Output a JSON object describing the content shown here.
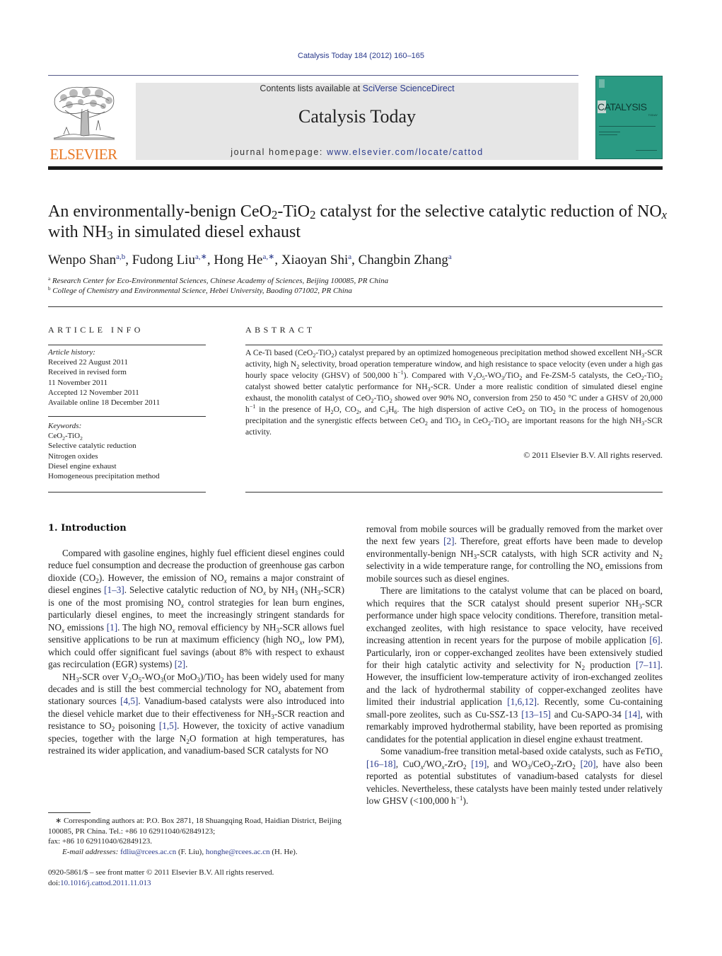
{
  "header": {
    "citation": "Catalysis Today 184 (2012) 160–165",
    "contents_prefix": "Contents lists available at ",
    "contents_link": "SciVerse ScienceDirect",
    "journal_title": "Catalysis Today",
    "homepage_prefix": "journal homepage: ",
    "homepage_link": "www.elsevier.com/locate/cattod",
    "publisher_logo_text": "ELSEVIER",
    "cover_title": "CATALYSIS",
    "cover_subtitle": "TODAY",
    "colors": {
      "link": "#2a3a8c",
      "elsevier_orange": "#e87722",
      "banner_bg": "#e6e6e6",
      "cover_bg": "#2a9a83"
    }
  },
  "article": {
    "title_parts": {
      "p1": "An environmentally-benign CeO",
      "s1": "2",
      "p2": "-TiO",
      "s2": "2",
      "p3": " catalyst for the selective catalytic reduction of NO",
      "s3": "x",
      "p4": " with NH",
      "s4": "3",
      "p5": " in simulated diesel exhaust"
    },
    "authors": [
      {
        "name": "Wenpo Shan",
        "sup": "a,b"
      },
      {
        "name": "Fudong Liu",
        "sup": "a,∗"
      },
      {
        "name": "Hong He",
        "sup": "a,∗"
      },
      {
        "name": "Xiaoyan Shi",
        "sup": "a"
      },
      {
        "name": "Changbin Zhang",
        "sup": "a"
      }
    ],
    "affiliations": [
      {
        "mark": "a",
        "text": "Research Center for Eco-Environmental Sciences, Chinese Academy of Sciences, Beijing 100085, PR China"
      },
      {
        "mark": "b",
        "text": "College of Chemistry and Environmental Science, Hebei University, Baoding 071002, PR China"
      }
    ]
  },
  "article_info": {
    "heading": "ARTICLE INFO",
    "history_label": "Article history:",
    "history": [
      "Received 22 August 2011",
      "Received in revised form",
      "11 November 2011",
      "Accepted 12 November 2011",
      "Available online 18 December 2011"
    ],
    "keywords_label": "Keywords:",
    "keyword_first": {
      "a": "CeO",
      "b": "2",
      "c": "-TiO",
      "d": "2"
    },
    "keywords": [
      "Selective catalytic reduction",
      "Nitrogen oxides",
      "Diesel engine exhaust",
      "Homogeneous precipitation method"
    ]
  },
  "abstract": {
    "heading": "ABSTRACT",
    "copyright": "© 2011 Elsevier B.V. All rights reserved.",
    "t": {
      "a1": "A Ce-Ti based (CeO",
      "a2": "-TiO",
      "a3": ") catalyst prepared by an optimized homogeneous precipitation method showed excellent NH",
      "a4": "-SCR activity, high N",
      "a5": " selectivity, broad operation temperature window, and high resistance to space velocity (even under a high gas hourly space velocity (GHSV) of 500,000 h",
      "a6": "). Compared with V",
      "a7": "O",
      "a8": "-WO",
      "a9": "/TiO",
      "a10": " and Fe-ZSM-5 catalysts, the CeO",
      "a11": "-TiO",
      "a12": " catalyst showed better catalytic performance for NH",
      "a13": "-SCR. Under a more realistic condition of simulated diesel engine exhaust, the monolith catalyst of CeO",
      "a14": "-TiO",
      "a15": " showed over 90% NO",
      "a16": " conversion from 250 to 450 °C under a GHSV of 20,000 h",
      "a17": " in the presence of H",
      "a18": "O, CO",
      "a19": ", and C",
      "a20": "H",
      "a21": ". The high dispersion of active CeO",
      "a22": " on TiO",
      "a23": " in the process of homogenous precipitation and the synergistic effects between CeO",
      "a24": " and TiO",
      "a25": " in CeO",
      "a26": "-TiO",
      "a27": " are important reasons for the high NH",
      "a28": "-SCR activity.",
      "n2": "2",
      "n3": "3",
      "n5": "5",
      "n6": "6",
      "x": "x",
      "m1": "−1"
    }
  },
  "introduction": {
    "heading": "1.  Introduction",
    "refs": {
      "r13": "[1–3]",
      "r1": "[1]",
      "r2": "[2]",
      "r45": "[4,5]",
      "r15": "[1,5]",
      "r6": "[6]",
      "r711": "[7–11]",
      "r1612": "[1,6,12]",
      "r1315": "[13–15]",
      "r14": "[14]",
      "r1618": "[16–18]",
      "r19": "[19]",
      "r20": "[20]"
    },
    "p1": {
      "a": "Compared with gasoline engines, highly fuel efficient diesel engines could reduce fuel consumption and decrease the production of greenhouse gas carbon dioxide (CO",
      "b": "). However, the emission of NO",
      "c": " remains a major constraint of diesel engines ",
      "d": ". Selective catalytic reduction of NO",
      "e": " by NH",
      "f": " (NH",
      "g": "-SCR) is one of the most promising NO",
      "h": " control strategies for lean burn engines, particularly diesel engines, to meet the increasingly stringent standards for NO",
      "i": " emissions ",
      "j": ". The high NO",
      "k": " removal efficiency by NH",
      "l": "-SCR allows fuel sensitive applications to be run at maximum efficiency (high NO",
      "m": ", low PM), which could offer significant fuel savings (about 8% with respect to exhaust gas recirculation (EGR) systems) ",
      "n": "."
    },
    "p2": {
      "a": "NH",
      "b": "-SCR over V",
      "c": "O",
      "d": "-WO",
      "e": "(or MoO",
      "f": ")/TiO",
      "g": " has been widely used for many decades and is still the best commercial technology for NO",
      "h": " abatement from stationary sources ",
      "i": ". Vanadium-based catalysts were also introduced into the diesel vehicle market due to their effectiveness for NH",
      "j": "-SCR reaction and resistance to SO",
      "k": " poisoning ",
      "l": ". However, the toxicity of active vanadium species, together with the large N",
      "m": "O formation at high temperatures, has restrained its wider application, and vanadium-based SCR catalysts for NO",
      "n": " removal from mobile sources will be gradually removed from the market over the next few years ",
      "o": ". Therefore, great efforts have been made to develop environmentally-benign NH",
      "p": "-SCR catalysts, with high SCR activity and N",
      "q": " selectivity in a wide temperature range, for controlling the NO",
      "r": " emissions from mobile sources such as diesel engines."
    },
    "p3": {
      "a": "There are limitations to the catalyst volume that can be placed on board, which requires that the SCR catalyst should present superior NH",
      "b": "-SCR performance under high space velocity conditions. Therefore, transition metal-exchanged zeolites, with high resistance to space velocity, have received increasing attention in recent years for the purpose of mobile application ",
      "c": ". Particularly, iron or copper-exchanged zeolites have been extensively studied for their high catalytic activity and selectivity for N",
      "d": " production ",
      "e": ". However, the insufficient low-temperature activity of iron-exchanged zeolites and the lack of hydrothermal stability of copper-exchanged zeolites have limited their industrial application ",
      "f": ". Recently, some Cu-containing small-pore zeolites, such as Cu-SSZ-13 ",
      "g": " and Cu-SAPO-34 ",
      "h": ", with remarkably improved hydrothermal stability, have been reported as promising candidates for the potential application in diesel engine exhaust treatment."
    },
    "p4": {
      "a": "Some vanadium-free transition metal-based oxide catalysts, such as FeTiO",
      "b": " ",
      "c": ", CuO",
      "d": "/WO",
      "e": "-ZrO",
      "f": " ",
      "g": ", and WO",
      "h": "/CeO",
      "i": "-ZrO",
      "j": " ",
      "k": ", have also been reported as potential substitutes of vanadium-based catalysts for diesel vehicles. Nevertheless, these catalysts have been mainly tested under relatively low GHSV (<100,000 h",
      "l": ")."
    }
  },
  "footnotes": {
    "corresponding": "∗ Corresponding authors at: P.O. Box 2871, 18 Shuangqing Road, Haidian District, Beijing 100085, PR China. Tel.: +86 10 62911040/62849123;",
    "fax": "fax: +86 10 62911040/62849123.",
    "email_label": "E-mail addresses:",
    "email1": "fdliu@rcees.ac.cn",
    "email1_name": " (F. Liu), ",
    "email2": "honghe@rcees.ac.cn",
    "email2_name": " (H. He).",
    "issn": "0920-5861/$ – see front matter © 2011 Elsevier B.V. All rights reserved.",
    "doi_label": "doi:",
    "doi": "10.1016/j.cattod.2011.11.013"
  }
}
